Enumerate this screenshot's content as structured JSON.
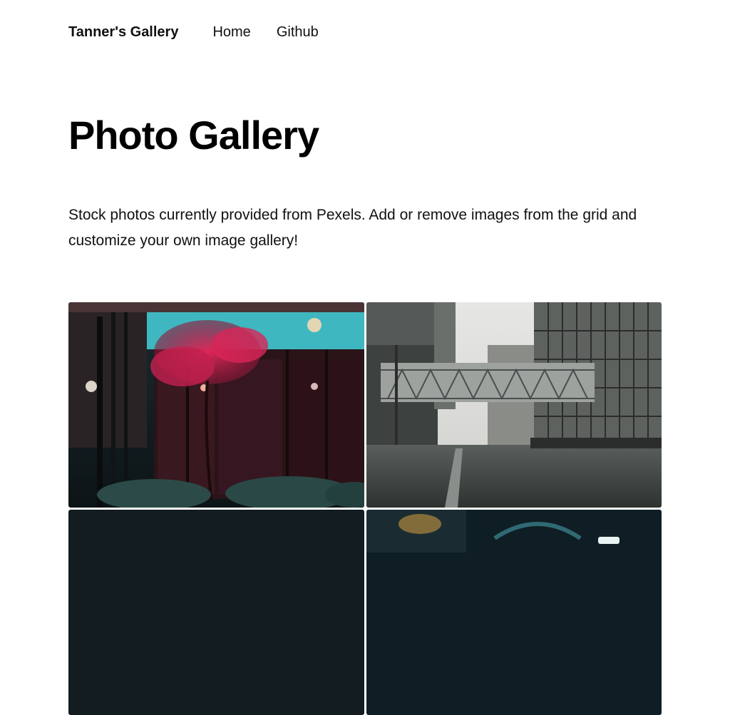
{
  "nav": {
    "brand": "Tanner's Gallery",
    "links": [
      {
        "label": "Home"
      },
      {
        "label": "Github"
      }
    ]
  },
  "hero": {
    "title": "Photo Gallery",
    "description": "Stock photos currently provided from Pexels. Add or remove images from the grid and customize your own image gallery!"
  },
  "colors": {
    "text": "#111111",
    "background": "#ffffff"
  }
}
